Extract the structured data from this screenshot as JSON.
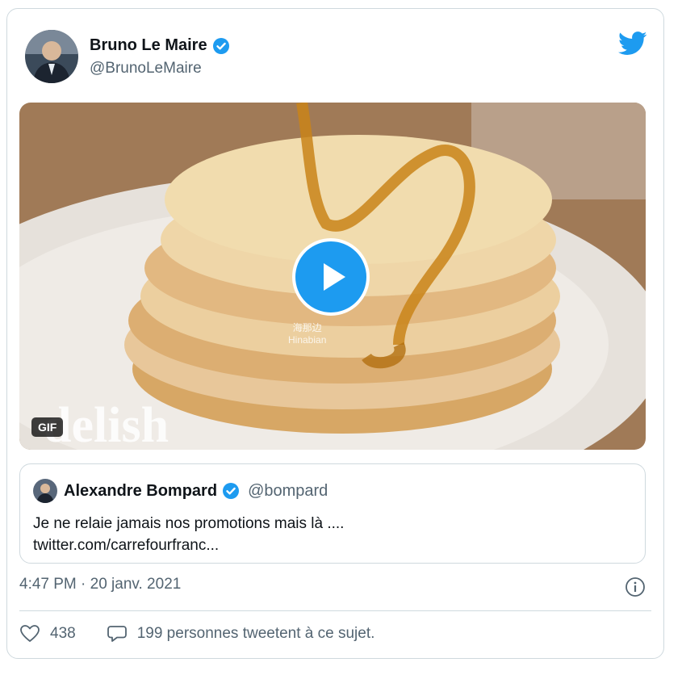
{
  "author": {
    "name": "Bruno Le Maire",
    "handle": "@BrunoLeMaire"
  },
  "media": {
    "gif_badge": "GIF",
    "brand_overlay": "delish",
    "watermark_cn": "海那边",
    "watermark_en": "Hinabian"
  },
  "quoted": {
    "name": "Alexandre Bompard",
    "handle": "@bompard",
    "text_line1": "Je ne relaie jamais nos promotions mais là ....",
    "text_line2": "twitter.com/carrefourfranc..."
  },
  "meta": {
    "timestamp": "4:47 PM · 20 janv. 2021"
  },
  "actions": {
    "likes": "438",
    "discussion": "199 personnes tweetent à ce sujet."
  },
  "colors": {
    "accent": "#1d9bf0",
    "muted": "#536471",
    "border": "#cfd9de"
  }
}
